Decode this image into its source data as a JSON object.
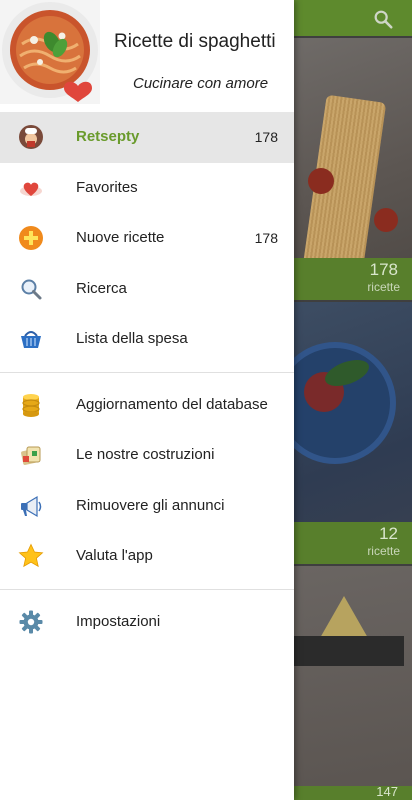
{
  "drawer": {
    "title": "Ricette di spaghetti",
    "subtitle": "Cucinare con amore",
    "section1": [
      {
        "label": "Retsepty",
        "count": "178",
        "icon": "chef-icon",
        "active": true
      },
      {
        "label": "Favorites",
        "count": "",
        "icon": "heart-icon"
      },
      {
        "label": "Nuove ricette",
        "count": "178",
        "icon": "plus-circle-icon"
      },
      {
        "label": "Ricerca",
        "count": "",
        "icon": "search-icon"
      },
      {
        "label": "Lista della spesa",
        "count": "",
        "icon": "basket-icon"
      }
    ],
    "section2": [
      {
        "label": "Aggiornamento del database",
        "icon": "database-icon"
      },
      {
        "label": "Le nostre costruzioni",
        "icon": "apps-icon"
      },
      {
        "label": "Rimuovere gli annunci",
        "icon": "megaphone-icon"
      },
      {
        "label": "Valuta l'app",
        "icon": "star-icon"
      }
    ],
    "section3": [
      {
        "label": "Impostazioni",
        "icon": "gear-icon"
      }
    ]
  },
  "background": {
    "cards": [
      {
        "count": "178",
        "label": "ricette"
      },
      {
        "count": "12",
        "label": "ricette"
      },
      {
        "count": "147",
        "label": ""
      }
    ]
  },
  "colors": {
    "accent": "#6a9b2c",
    "topbar": "#5e8a2d",
    "active_bg": "#e6e6e6"
  }
}
